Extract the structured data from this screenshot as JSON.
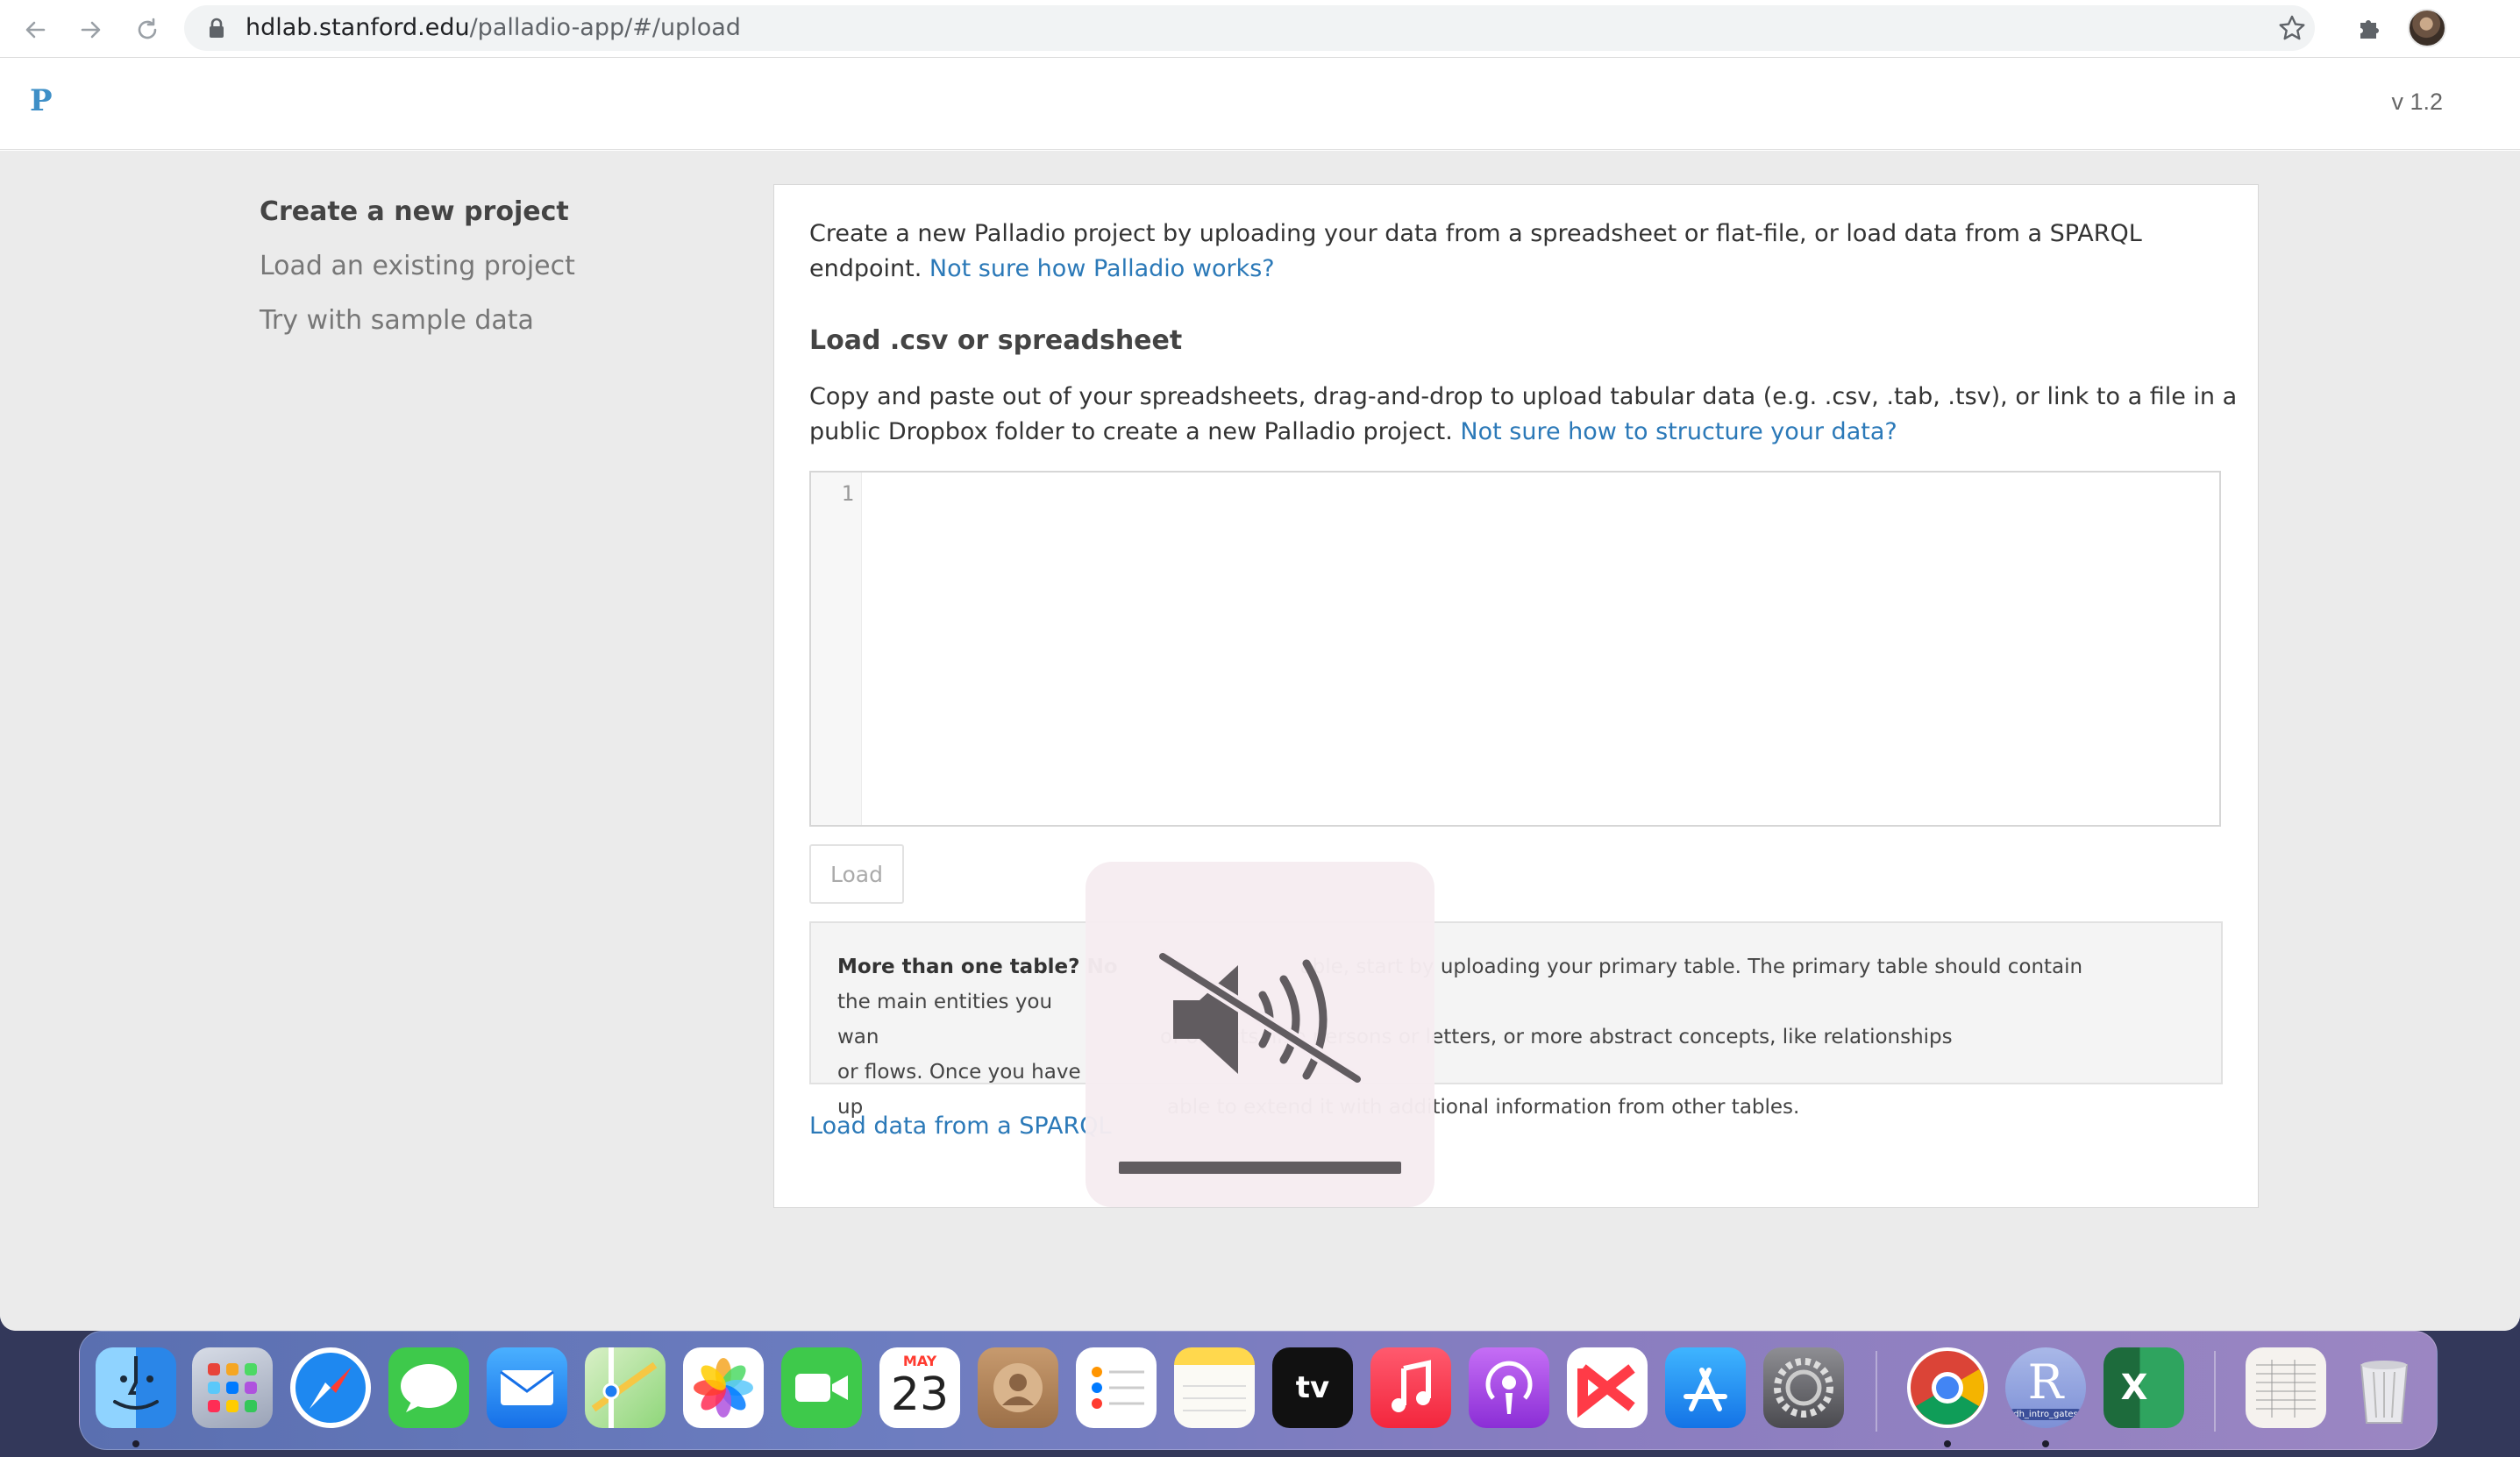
{
  "browser": {
    "url_host": "hdlab.stanford.edu",
    "url_path": "/palladio-app/#/upload"
  },
  "app": {
    "logo": "P",
    "version": "v 1.2"
  },
  "sidebar": {
    "items": [
      {
        "label": "Create a new project",
        "active": true
      },
      {
        "label": "Load an existing project",
        "active": false
      },
      {
        "label": "Try with sample data",
        "active": false
      }
    ]
  },
  "main": {
    "intro_text": "Create a new Palladio project by uploading your data from a spreadsheet or flat-file, or load data from a SPARQL endpoint.",
    "intro_link": "Not sure how Palladio works?",
    "section_title": "Load .csv or spreadsheet",
    "instructions_text": "Copy and paste out of your spreadsheets, drag-and-drop to upload tabular data (e.g. .csv, .tab, .tsv), or link to a file in a public Dropbox folder to create a new Palladio project.",
    "instructions_link": "Not sure how to structure your data?",
    "editor_line_number": "1",
    "load_button": "Load",
    "tip_bold_left": "More than one table? No",
    "tip_line1_right": "able, start by uploading your primary table. The primary table should contain",
    "tip_line2_left": "the main entities you wan",
    "tip_line2_right": "of objects, like persons or letters, or more abstract concepts, like relationships",
    "tip_line3_left": "or flows. Once you have up",
    "tip_line3_right": "able to extend it with additional information from other tables.",
    "sparql_link": "Load data from a SPARQL"
  },
  "hud": {
    "icon": "speaker-muted-icon",
    "volume": 1.0
  },
  "dock": {
    "calendar_month": "MAY",
    "calendar_day": "23",
    "tv_label": "tv",
    "r_letter": "R",
    "r_badge": "dh_intro_gates",
    "excel_letter": "X"
  },
  "colors": {
    "link": "#2b79b8",
    "logo": "#3e8fc7",
    "content_bg": "#ebebeb"
  }
}
